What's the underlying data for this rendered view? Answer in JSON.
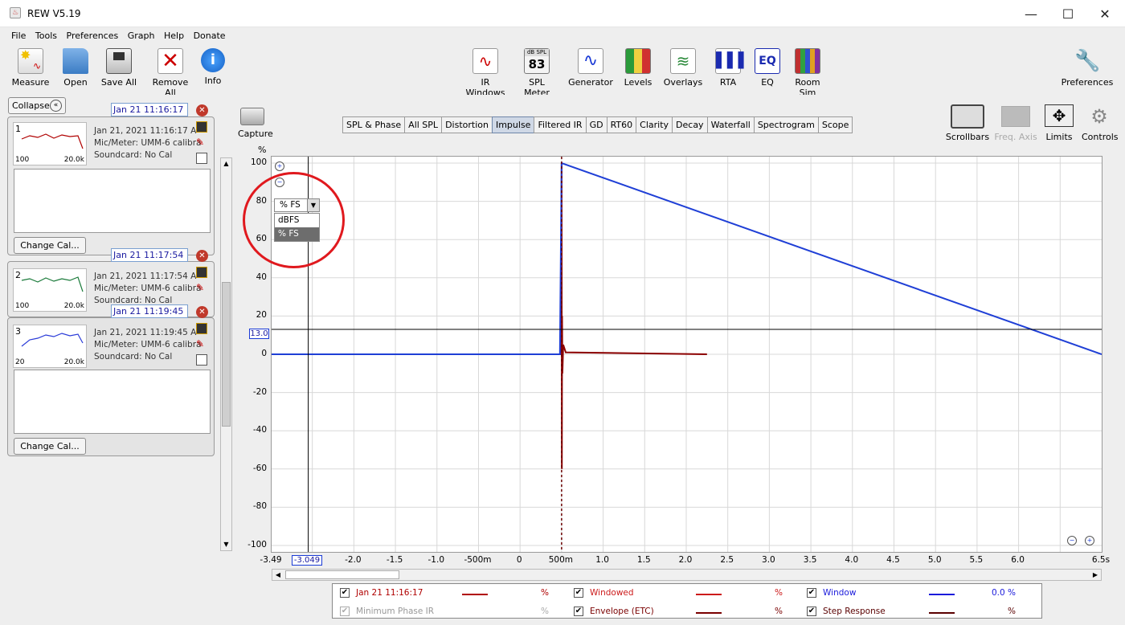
{
  "window": {
    "title": "REW V5.19",
    "minimize": "—",
    "maximize": "☐",
    "close": "✕"
  },
  "menu": [
    "File",
    "Tools",
    "Preferences",
    "Graph",
    "Help",
    "Donate"
  ],
  "toolbar_left": [
    {
      "label": "Measure",
      "icon": "measure-icon"
    },
    {
      "label": "Open",
      "icon": "folder-icon"
    },
    {
      "label": "Save All",
      "icon": "save-icon"
    },
    {
      "label": "Remove All",
      "icon": "remove-icon"
    },
    {
      "label": "Info",
      "icon": "info-icon"
    }
  ],
  "toolbar_center": [
    {
      "label": "IR Windows",
      "icon": "ir-windows-icon"
    },
    {
      "label": "SPL Meter",
      "icon": "spl-meter-icon",
      "top": "dB SPL",
      "value": "83"
    },
    {
      "label": "Generator",
      "icon": "generator-icon"
    },
    {
      "label": "Levels",
      "icon": "levels-icon"
    },
    {
      "label": "Overlays",
      "icon": "overlays-icon"
    },
    {
      "label": "RTA",
      "icon": "rta-icon"
    },
    {
      "label": "EQ",
      "icon": "eq-icon"
    },
    {
      "label": "Room Sim",
      "icon": "room-sim-icon"
    }
  ],
  "toolbar_right": {
    "label": "Preferences",
    "icon": "wrench-icon"
  },
  "sidebar": {
    "collapse_label": "Collapse",
    "change_cal_label": "Change Cal...",
    "measurements": [
      {
        "index": "1",
        "name": "Jan 21 11:16:17",
        "date": "Jan 21, 2021 11:16:17 A",
        "mic": "Mic/Meter: UMM-6 calibra",
        "soundcard": "Soundcard: No Cal",
        "low": "100",
        "high": "20.0k",
        "color": "#b00000"
      },
      {
        "index": "2",
        "name": "Jan 21 11:17:54",
        "date": "Jan 21, 2021 11:17:54 A",
        "mic": "Mic/Meter: UMM-6 calibra",
        "soundcard": "Soundcard: No Cal",
        "low": "100",
        "high": "20.0k",
        "color": "#1a7a3a"
      },
      {
        "index": "3",
        "name": "Jan 21 11:19:45",
        "date": "Jan 21, 2021 11:19:45 A",
        "mic": "Mic/Meter: UMM-6 calibra",
        "soundcard": "Soundcard: No Cal",
        "low": "20",
        "high": "20.0k",
        "color": "#2a3bd8"
      }
    ]
  },
  "capture_label": "Capture",
  "tabs": [
    "SPL & Phase",
    "All SPL",
    "Distortion",
    "Impulse",
    "Filtered IR",
    "GD",
    "RT60",
    "Clarity",
    "Decay",
    "Waterfall",
    "Spectrogram",
    "Scope"
  ],
  "selected_tab": "Impulse",
  "graph_controls": [
    {
      "label": "Scrollbars",
      "icon": "scrollbars-icon"
    },
    {
      "label": "Freq. Axis",
      "icon": "freq-axis-icon",
      "disabled": true
    },
    {
      "label": "Limits",
      "icon": "limits-icon"
    },
    {
      "label": "Controls",
      "icon": "gear-icon"
    }
  ],
  "y_unit": "%",
  "dropdown": {
    "selected": "% FS",
    "options": [
      "dBFS",
      "% FS"
    ],
    "highlighted": "% FS"
  },
  "cursor": {
    "y_value": "13.0",
    "x_value": "-3.049"
  },
  "chart_data": {
    "type": "line",
    "ylim": [
      -100,
      100
    ],
    "yticks": [
      100,
      80,
      60,
      40,
      20,
      0,
      -20,
      -40,
      -60,
      -80,
      -100
    ],
    "xlim": [
      -3.49,
      6.5
    ],
    "xticks": [
      -3.0,
      -2.5,
      -2.0,
      -1.5,
      -1.0,
      -0.5,
      0,
      0.5,
      1.0,
      1.5,
      2.0,
      2.5,
      3.0,
      3.5,
      4.0,
      4.5,
      5.0,
      5.5,
      6.0
    ],
    "xtick_labels": [
      "-3.49",
      "-2.5",
      "-2.0",
      "-1.5",
      "-1.0",
      "-500m",
      "0",
      "500m",
      "1.0",
      "1.5",
      "2.0",
      "2.5",
      "3.0",
      "3.5",
      "4.0",
      "4.5",
      "5.0",
      "5.5",
      "6.0",
      "6.5s"
    ],
    "series": [
      {
        "name": "Jan 21 11:16:17",
        "color": "#8b0000",
        "x": [
          -1.0,
          -0.01,
          0,
          0.003,
          0.006,
          0.01,
          0.02,
          0.05,
          1.75
        ],
        "y": [
          0,
          0,
          100,
          -60,
          20,
          -10,
          5,
          1,
          0
        ]
      },
      {
        "name": "Window",
        "color": "#1f3fd6",
        "x": [
          -3.49,
          -0.02,
          0,
          6.5
        ],
        "y": [
          0,
          0,
          100,
          0
        ]
      }
    ],
    "cursor_x": -3.049,
    "cursor_y": 13.0,
    "peak_marker_x": 0
  },
  "legend": [
    {
      "label": "Jan 21 11:16:17",
      "checked": true,
      "value": "%",
      "color": "#b00000",
      "disabled": false
    },
    {
      "label": "Windowed",
      "checked": true,
      "value": "%",
      "color": "#cc1a1a",
      "disabled": false
    },
    {
      "label": "Window",
      "checked": true,
      "value": "0.0 %",
      "color": "#1a1adb",
      "disabled": false
    },
    {
      "label": "Minimum Phase IR",
      "checked": true,
      "value": "%",
      "color": "#999999",
      "disabled": true
    },
    {
      "label": "Envelope (ETC)",
      "checked": true,
      "value": "%",
      "color": "#7a0000",
      "disabled": false
    },
    {
      "label": "Step Response",
      "checked": true,
      "value": "%",
      "color": "#5a0000",
      "disabled": false
    }
  ]
}
